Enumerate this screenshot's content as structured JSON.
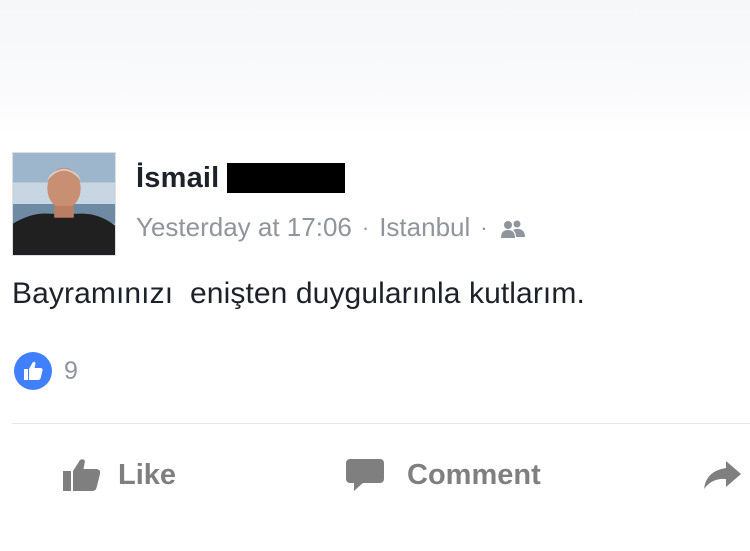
{
  "post": {
    "author": {
      "first_name": "İsmail",
      "last_name_redacted": true,
      "avatar": "profile-photo"
    },
    "meta": {
      "time": "Yesterday at 17:06",
      "separator": "·",
      "location": "Istanbul",
      "audience_icon": "friends-icon"
    },
    "text": "Bayramınızı  enişten duygularınla kutlarım.",
    "reactions": {
      "icon": "like-icon",
      "count": "9",
      "color": "#4080ff"
    },
    "actions": {
      "like_label": "Like",
      "comment_label": "Comment",
      "share_icon": "share-arrow-icon"
    }
  }
}
